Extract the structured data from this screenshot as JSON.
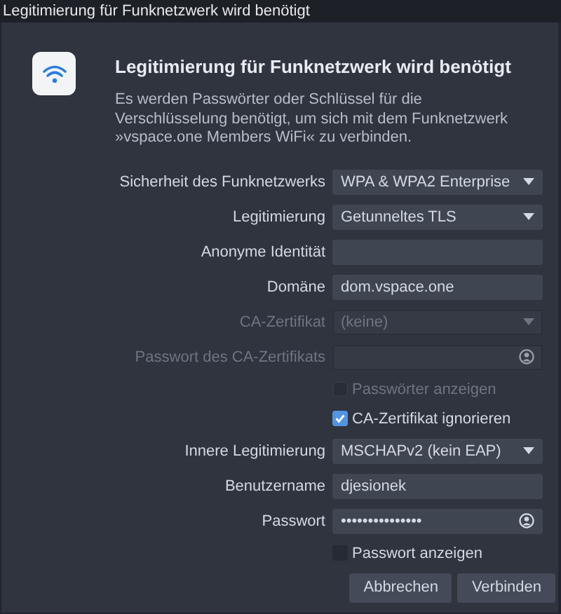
{
  "window": {
    "title": "Legitimierung für Funknetzwerk wird benötigt"
  },
  "header": {
    "title": "Legitimierung für Funknetzwerk wird benötigt",
    "message": "Es werden Passwörter oder Schlüssel für die Verschlüsselung benötigt, um sich mit dem Funknetzwerk »vspace.one Members WiFi« zu verbinden."
  },
  "fields": [
    {
      "kind": "dropdown",
      "label": "Sicherheit des Funknetzwerks",
      "value": "WPA & WPA2 Enterprise",
      "disabled": false
    },
    {
      "kind": "dropdown",
      "label": "Legitimierung",
      "value": "Getunneltes TLS",
      "disabled": false
    },
    {
      "kind": "entry",
      "label": "Anonyme Identität",
      "disabled": false
    },
    {
      "kind": "entry",
      "label": "Domäne",
      "value": "dom.vspace.one",
      "disabled": false
    },
    {
      "kind": "dropdown",
      "label": "CA-Zertifikat",
      "value": "(keine)",
      "disabled": true
    },
    {
      "kind": "password",
      "label": "Passwort des CA-Zertifikats",
      "disabled": true
    },
    {
      "kind": "checkbox",
      "label": "Passwörter anzeigen",
      "checked": false,
      "disabled": true
    },
    {
      "kind": "checkbox",
      "label": "CA-Zertifikat ignorieren",
      "checked": true,
      "disabled": false
    },
    {
      "kind": "dropdown",
      "label": "Innere Legitimierung",
      "value": "MSCHAPv2 (kein EAP)",
      "disabled": false
    },
    {
      "kind": "entry",
      "label": "Benutzername",
      "value": "djesionek",
      "disabled": false
    },
    {
      "kind": "password",
      "label": "Passwort",
      "value": "•••••••••••••••",
      "disabled": false
    },
    {
      "kind": "checkbox",
      "label": "Passwort anzeigen",
      "checked": false,
      "disabled": false
    }
  ],
  "buttons": [
    "Abbrechen",
    "Verbinden"
  ]
}
